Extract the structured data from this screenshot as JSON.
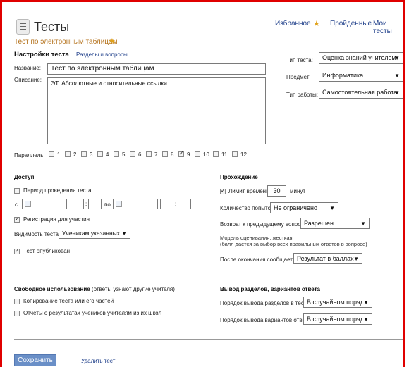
{
  "header": {
    "title": "Тесты",
    "subtitle": "Тест по электронным таблицам",
    "nav_favorites": "Избранное",
    "nav_passed": "Пройденные",
    "nav_my_tests": "Мои тесты"
  },
  "tabs": {
    "settings": "Настройки теста",
    "sections": "Разделы и вопросы"
  },
  "form": {
    "name_label": "Название:",
    "name_value": "Тест по электронным таблицам",
    "desc_label": "Описание:",
    "desc_value": "ЭТ. Абсолютные и относительные ссылки",
    "test_type_label": "Тип теста:",
    "test_type_value": "Оценка знаний учителем",
    "subject_label": "Предмет:",
    "subject_value": "Информатика",
    "work_type_label": "Тип работы:",
    "work_type_value": "Самостоятельная работа",
    "parallel_label": "Параллель:",
    "grades": [
      "1",
      "2",
      "3",
      "4",
      "5",
      "6",
      "7",
      "8",
      "9",
      "10",
      "11",
      "12"
    ],
    "grade_checked": "9"
  },
  "access": {
    "heading": "Доступ",
    "period_label": "Период проведения теста:",
    "from_label": "с",
    "to_label": "по",
    "colon": ":",
    "registration_label": "Регистрация для участия",
    "visibility_label": "Видимость теста:",
    "visibility_value": "Ученикам указанных п",
    "published_label": "Тест опубликован"
  },
  "passing": {
    "heading": "Прохождение",
    "time_limit_label": "Лимит времени:",
    "time_limit_value": "30",
    "time_limit_unit": "минут",
    "attempts_label": "Количество попыток:",
    "attempts_value": "Не ограничено",
    "return_label": "Возврат к предыдущему вопросу:",
    "return_value": "Разрешен",
    "model_line1": "Модель оценивания: жесткая",
    "model_line2": "(балл дается за выбор всех правильных ответов в вопросе)",
    "after_label": "После окончания сообщается:",
    "after_value": "Результат в баллах"
  },
  "free_use": {
    "heading": "Свободное использование",
    "heading_note": "(ответы узнают другие учителя)",
    "copy_label": "Копирование теста или его частей",
    "reports_label": "Отчеты о результатах учеников учителям из их школ"
  },
  "order": {
    "heading": "Вывод разделов, вариантов ответа",
    "sections_label": "Порядок вывода разделов в тесте:",
    "sections_value": "В случайном порядк",
    "variants_label": "Порядок вывода вариантов ответа:",
    "variants_value": "В случайном порядк"
  },
  "footer": {
    "save": "Сохранить",
    "delete": "Удалить тест"
  },
  "icons": {
    "star": "★",
    "check": "✓",
    "arrow": "▼",
    "calendar": "calendar-icon"
  },
  "colors": {
    "frame": "#e00000",
    "link": "#1f3f8a",
    "subtitle": "#b4721c",
    "star": "#e0a21a",
    "button": "#6a8fc7"
  }
}
